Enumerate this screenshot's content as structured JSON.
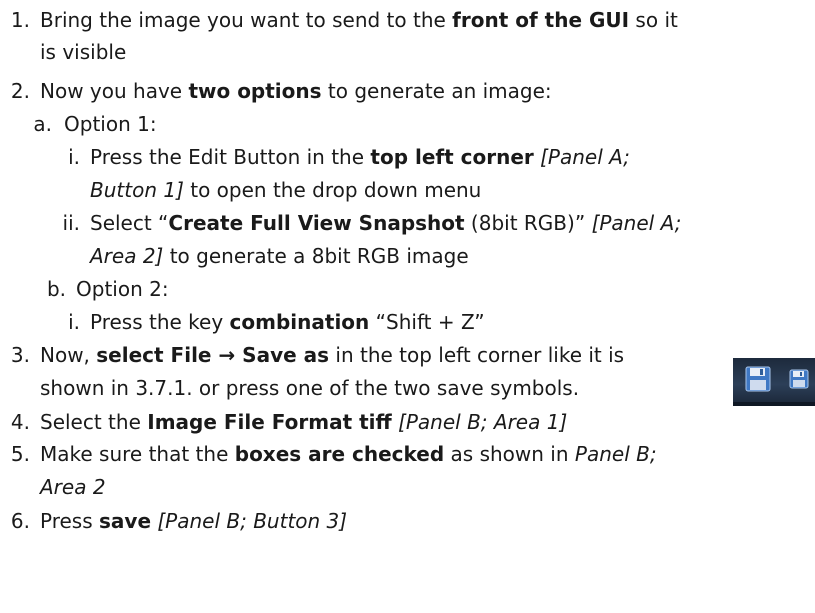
{
  "steps": [
    {
      "num": "1.",
      "lines": [
        [
          {
            "t": "Bring the image you want to send to the "
          },
          {
            "t": "front of the GUI",
            "b": true
          },
          {
            "t": " so it"
          }
        ],
        [
          {
            "t": "is visible"
          }
        ]
      ]
    },
    {
      "num": "2.",
      "lines": [
        [
          {
            "t": "Now you have "
          },
          {
            "t": "two options",
            "b": true
          },
          {
            "t": " to generate an image:"
          }
        ]
      ]
    },
    {
      "num": "a.",
      "lines": [
        [
          {
            "t": "Option 1:"
          }
        ]
      ]
    },
    {
      "num": "i.",
      "lines": [
        [
          {
            "t": "Press the Edit Button in the "
          },
          {
            "t": "top left corner",
            "b": true
          },
          {
            "t": " "
          },
          {
            "t": "[Panel A;",
            "i": true
          }
        ],
        [
          {
            "t": "Button 1]",
            "i": true
          },
          {
            "t": " to open the drop down menu"
          }
        ]
      ]
    },
    {
      "num": "ii.",
      "lines": [
        [
          {
            "t": "Select “"
          },
          {
            "t": "Create Full View Snapshot",
            "b": true
          },
          {
            "t": " (8bit RGB)” "
          },
          {
            "t": "[Panel A;",
            "i": true
          }
        ],
        [
          {
            "t": "Area 2]",
            "i": true
          },
          {
            "t": " to generate a 8bit RGB image"
          }
        ]
      ]
    },
    {
      "num": "b.",
      "lines": [
        [
          {
            "t": "Option 2:"
          }
        ]
      ]
    },
    {
      "num": "i.",
      "lines": [
        [
          {
            "t": "Press the key "
          },
          {
            "t": "combination",
            "b": true
          },
          {
            "t": " “Shift + Z”"
          }
        ]
      ]
    },
    {
      "num": "3.",
      "lines": [
        [
          {
            "t": "Now, "
          },
          {
            "t": "select File → Save as",
            "b": true
          },
          {
            "t": " in the top left corner like it is"
          }
        ],
        [
          {
            "t": "shown in 3.7.1. or press one of the two save symbols."
          }
        ]
      ]
    },
    {
      "num": "4.",
      "lines": [
        [
          {
            "t": "Select the "
          },
          {
            "t": "Image File Format tiff",
            "b": true
          },
          {
            "t": " "
          },
          {
            "t": "[Panel B; Area 1]",
            "i": true
          }
        ]
      ]
    },
    {
      "num": "5.",
      "lines": [
        [
          {
            "t": "Make sure that the "
          },
          {
            "t": "boxes are checked",
            "b": true
          },
          {
            "t": " as shown in "
          },
          {
            "t": "Panel B;",
            "i": true
          }
        ],
        [
          {
            "t": "Area 2",
            "i": true
          }
        ]
      ]
    },
    {
      "num": "6.",
      "lines": [
        [
          {
            "t": "Press "
          },
          {
            "t": "save",
            "b": true
          },
          {
            "t": " "
          },
          {
            "t": "[Panel B; Button 3]",
            "i": true
          }
        ]
      ]
    }
  ],
  "icons": [
    "save-icon",
    "save-small-icon"
  ]
}
